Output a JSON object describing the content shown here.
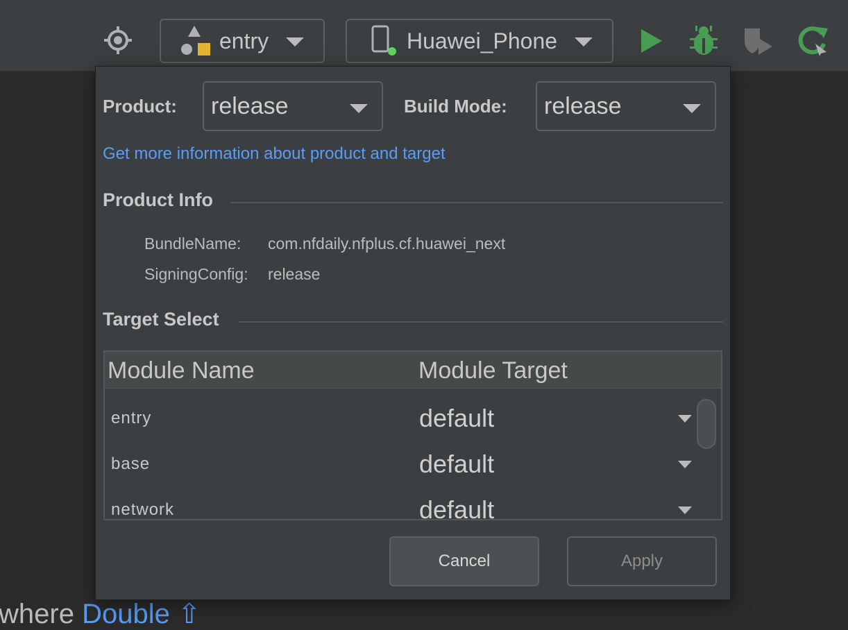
{
  "toolbar": {
    "module_selector": {
      "label": "entry"
    },
    "device_selector": {
      "label": "Huawei_Phone"
    },
    "colors": {
      "run": "#499c54",
      "debug": "#499c54",
      "attach": "#6e6e6e",
      "reload": "#499c54",
      "device_status": "#5fd35f"
    },
    "icons": [
      "target-icon",
      "module-icon",
      "phone-icon",
      "run-icon",
      "debug-icon",
      "attach-debugger-icon",
      "apply-changes-icon"
    ]
  },
  "background": {
    "hint_text": "ywhere",
    "hint_link": "Double ⇧"
  },
  "popup": {
    "product_label": "Product:",
    "product_value": "release",
    "build_mode_label": "Build Mode:",
    "build_mode_value": "release",
    "info_link": "Get more information about product and target",
    "product_info": {
      "title": "Product Info",
      "bundle_name_key": "BundleName:",
      "bundle_name_value": "com.nfdaily.nfplus.cf.huawei_next",
      "signing_config_key": "SigningConfig:",
      "signing_config_value": "release"
    },
    "target_select": {
      "title": "Target Select",
      "columns": [
        "Module Name",
        "Module Target"
      ],
      "rows": [
        {
          "name": "entry",
          "target": "default"
        },
        {
          "name": "base",
          "target": "default"
        },
        {
          "name": "network",
          "target": "default"
        }
      ]
    },
    "buttons": {
      "cancel": "Cancel",
      "apply": "Apply"
    }
  }
}
